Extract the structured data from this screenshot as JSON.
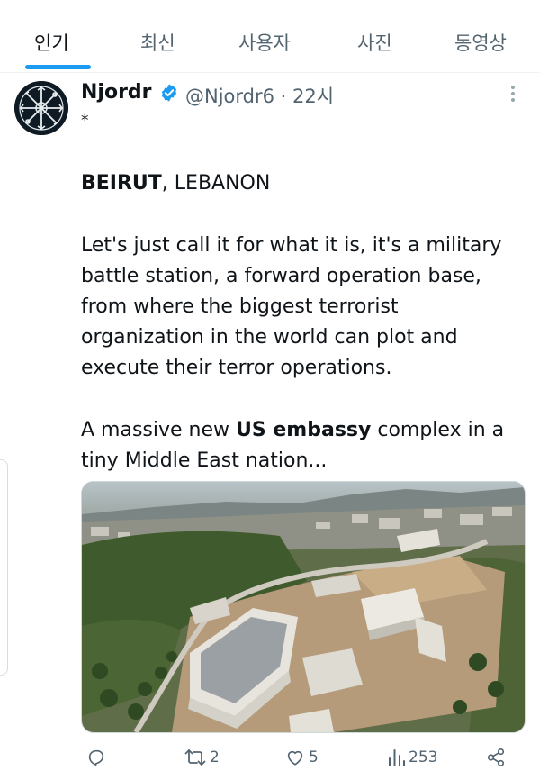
{
  "tabs": [
    {
      "label": "인기"
    },
    {
      "label": "최신"
    },
    {
      "label": "사용자"
    },
    {
      "label": "사진"
    },
    {
      "label": "동영상"
    }
  ],
  "tweet": {
    "name": "Njordr",
    "handle_time": "@Njordr6 · 22시",
    "asterisk": "*",
    "line1_bold": "BEIRUT",
    "line1_rest": ", LEBANON",
    "para1": [
      "Let's just call it for what it is, it's a military",
      "battle station, a forward operation base,",
      "from where the biggest terrorist",
      "organization in the world can plot and",
      "execute their terror operations."
    ],
    "para2_pre": "A massive new ",
    "para2_bold": "US embassy",
    "para2_post": " complex in a",
    "para2_line2": "tiny Middle East nation..."
  },
  "actions": {
    "reply_count": "",
    "retweet_count": "2",
    "like_count": "5",
    "view_count": "253"
  },
  "icons": [
    "reply-icon",
    "retweet-icon",
    "like-icon",
    "views-icon",
    "share-icon",
    "verified-icon",
    "more-icon"
  ],
  "colors": {
    "accent": "#1d9bf0",
    "muted": "#536471",
    "text": "#0f1419"
  }
}
